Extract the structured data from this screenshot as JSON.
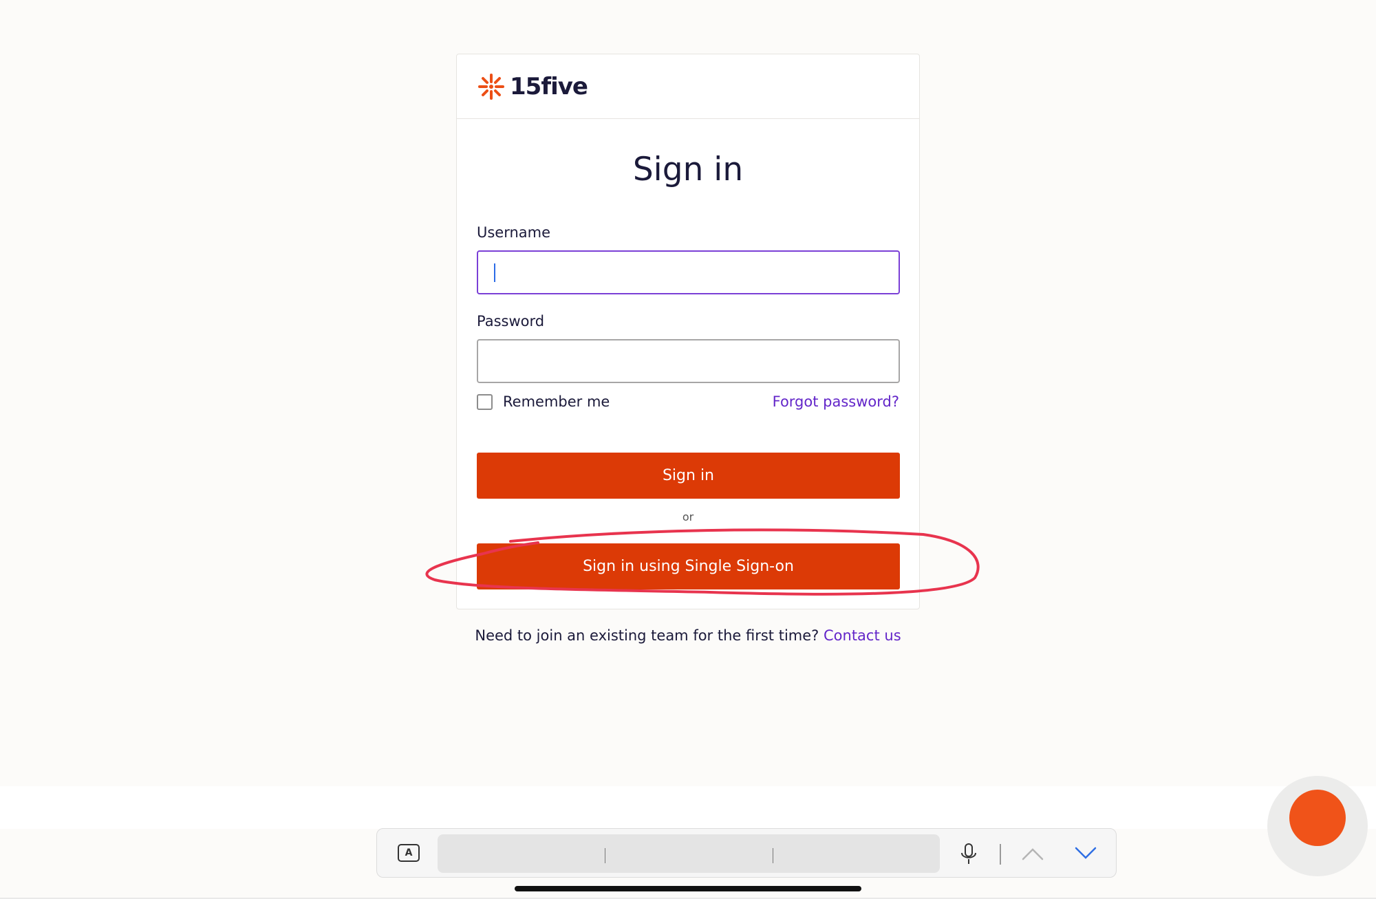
{
  "brand": {
    "name": "15five",
    "logo_icon": "sunburst-logo-icon",
    "accent_color": "#dc3a06",
    "link_color": "#6326c9"
  },
  "form": {
    "title": "Sign in",
    "username_label": "Username",
    "username_value": "",
    "password_label": "Password",
    "password_value": "",
    "remember_label": "Remember me",
    "remember_checked": false,
    "forgot_link": "Forgot password?",
    "signin_button": "Sign in",
    "divider": "or",
    "sso_button": "Sign in using Single Sign-on"
  },
  "footer": {
    "join_text": "Need to join an existing team for the first time?",
    "contact_link": "Contact us"
  },
  "keyboard_bar": {
    "icons": [
      "keyboard-a-icon",
      "microphone-icon",
      "chevron-up-icon",
      "chevron-down-icon"
    ]
  },
  "annotation": {
    "color": "#e8344e",
    "shape": "hand-drawn circle around SSO button"
  }
}
